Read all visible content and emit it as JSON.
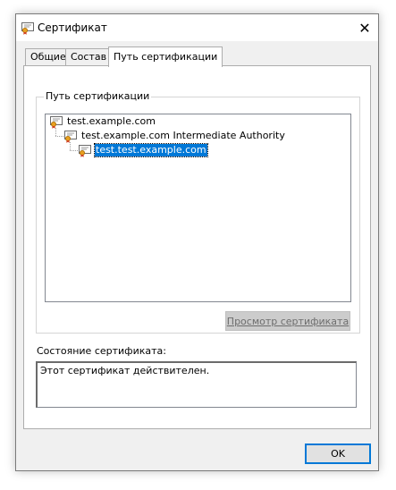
{
  "window": {
    "title": "Сертификат",
    "close_glyph": "✕"
  },
  "tabs": [
    {
      "label": "Общие",
      "active": false
    },
    {
      "label": "Состав",
      "active": false
    },
    {
      "label": "Путь сертификации",
      "active": true
    }
  ],
  "path_group": {
    "legend": "Путь сертификации",
    "nodes": [
      {
        "label": "test.example.com",
        "icon": "certificate-icon",
        "selected": false
      },
      {
        "label": "test.example.com Intermediate Authority",
        "icon": "certificate-icon",
        "selected": false
      },
      {
        "label": "test.test.example.com",
        "icon": "certificate-icon",
        "selected": true
      }
    ],
    "view_button_label": "Просмотр сертификата",
    "view_button_enabled": false
  },
  "status": {
    "label": "Состояние сертификата:",
    "text": "Этот сертификат действителен."
  },
  "ok_button_label": "OK",
  "colors": {
    "selection": "#0078d7",
    "dialog_bg": "#f0f0f0",
    "default_button_border": "#0078d7"
  }
}
